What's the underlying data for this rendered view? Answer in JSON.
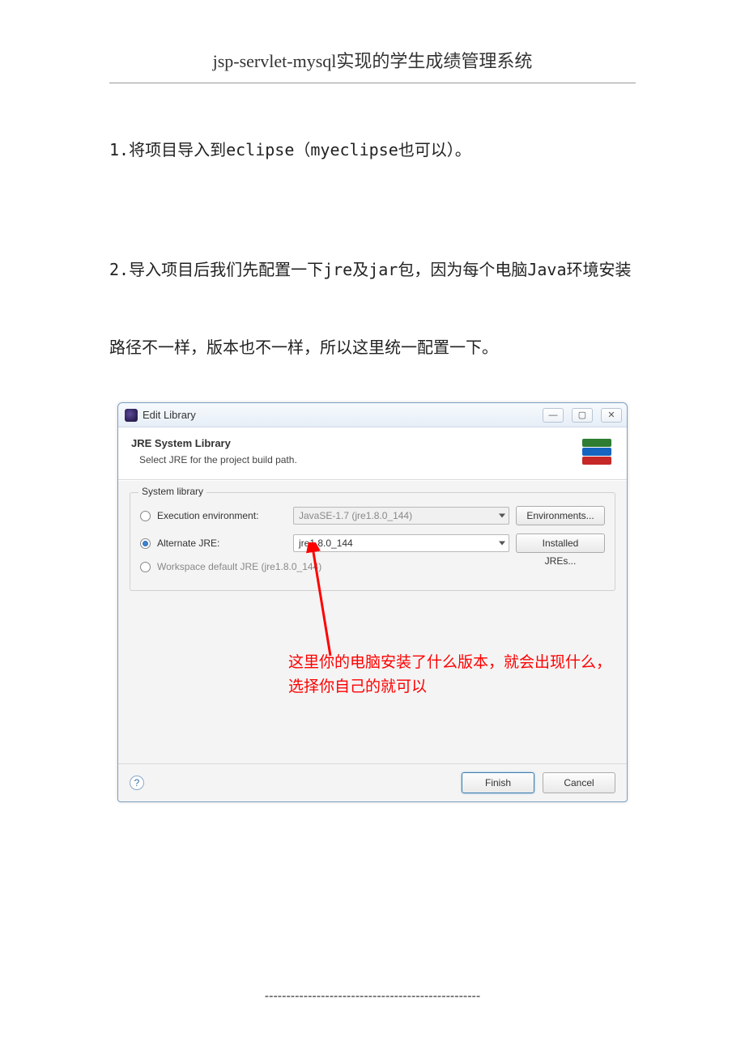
{
  "header": {
    "title": "jsp-servlet-mysql实现的学生成绩管理系统"
  },
  "paras": {
    "p1": "1.将项目导入到eclipse（myeclipse也可以）。",
    "p2": "2.导入项目后我们先配置一下jre及jar包，因为每个电脑Java环境安装路径不一样，版本也不一样，所以这里统一配置一下。"
  },
  "dialog": {
    "title": "Edit Library",
    "heading": "JRE System Library",
    "sub": "Select JRE for the project build path.",
    "group_label": "System library",
    "rows": {
      "exec_label": "Execution environment:",
      "exec_value": "JavaSE-1.7 (jre1.8.0_144)",
      "env_btn": "Environments...",
      "alt_label": "Alternate JRE:",
      "alt_value": "jre1.8.0_144",
      "installed_btn": "Installed JREs...",
      "ws_label": "Workspace default JRE (jre1.8.0_144)"
    },
    "annotation": "这里你的电脑安装了什么版本，就会出现什么，选择你自己的就可以",
    "finish": "Finish",
    "cancel": "Cancel"
  },
  "footer": {
    "dashes": "--------------------------------------------------"
  }
}
